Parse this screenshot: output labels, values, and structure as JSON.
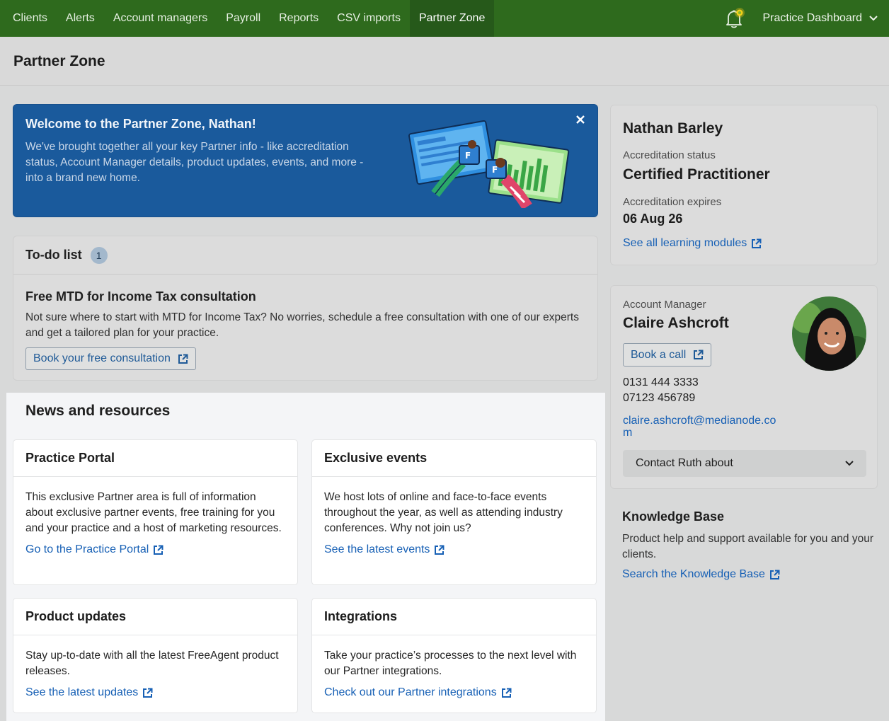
{
  "nav": {
    "items": [
      "Clients",
      "Alerts",
      "Account managers",
      "Payroll",
      "Reports",
      "CSV imports",
      "Partner Zone"
    ],
    "active": "Partner Zone",
    "dashboard_label": "Practice Dashboard",
    "accent": "#2e6a1d"
  },
  "page": {
    "title": "Partner Zone"
  },
  "welcome": {
    "title": "Welcome to the Partner Zone, Nathan!",
    "text": "We've brought together all your key Partner info - like accreditation status, Account Manager details, product updates, events, and more - into a brand new home.",
    "close_icon": "close-icon",
    "bg": "#1a5a9c"
  },
  "todo": {
    "title": "To-do list",
    "count": "1",
    "item_title": "Free MTD for Income Tax consultation",
    "item_text": "Not sure where to start with MTD for Income Tax? No worries, schedule a free consultation with one of our experts and get a tailored plan for your practice.",
    "button": "Book your free consultation"
  },
  "news": {
    "title": "News and resources",
    "cards": [
      {
        "title": "Practice Portal",
        "text": "This exclusive Partner area is full of information about exclusive partner events, free training for you and your practice and a host of marketing resources.",
        "link": "Go to the Practice Portal"
      },
      {
        "title": "Exclusive events",
        "text": "We host lots of online and face-to-face events throughout the year, as well as attending industry conferences. Why not join us?",
        "link": "See the latest events"
      },
      {
        "title": "Product updates",
        "text": "Stay up-to-date with all the latest FreeAgent product releases.",
        "link": "See the latest updates"
      },
      {
        "title": "Integrations",
        "text": "Take your practice’s processes to the next level with our Partner integrations.",
        "link": "Check out our Partner integrations"
      }
    ]
  },
  "profile": {
    "name": "Nathan Barley",
    "status_label": "Accreditation status",
    "status": "Certified Practitioner",
    "expires_label": "Accreditation expires",
    "expires": "06 Aug 26",
    "link": "See all learning modules"
  },
  "manager": {
    "role": "Account Manager",
    "name": "Claire Ashcroft",
    "book": "Book a call",
    "phone1": "0131 444 3333",
    "phone2": "07123 456789",
    "email": "claire.ashcroft@medianode.com",
    "contact_select": "Contact Ruth about"
  },
  "kb": {
    "title": "Knowledge Base",
    "text": "Product help and support available for you and your clients.",
    "link": "Search the Knowledge Base"
  }
}
